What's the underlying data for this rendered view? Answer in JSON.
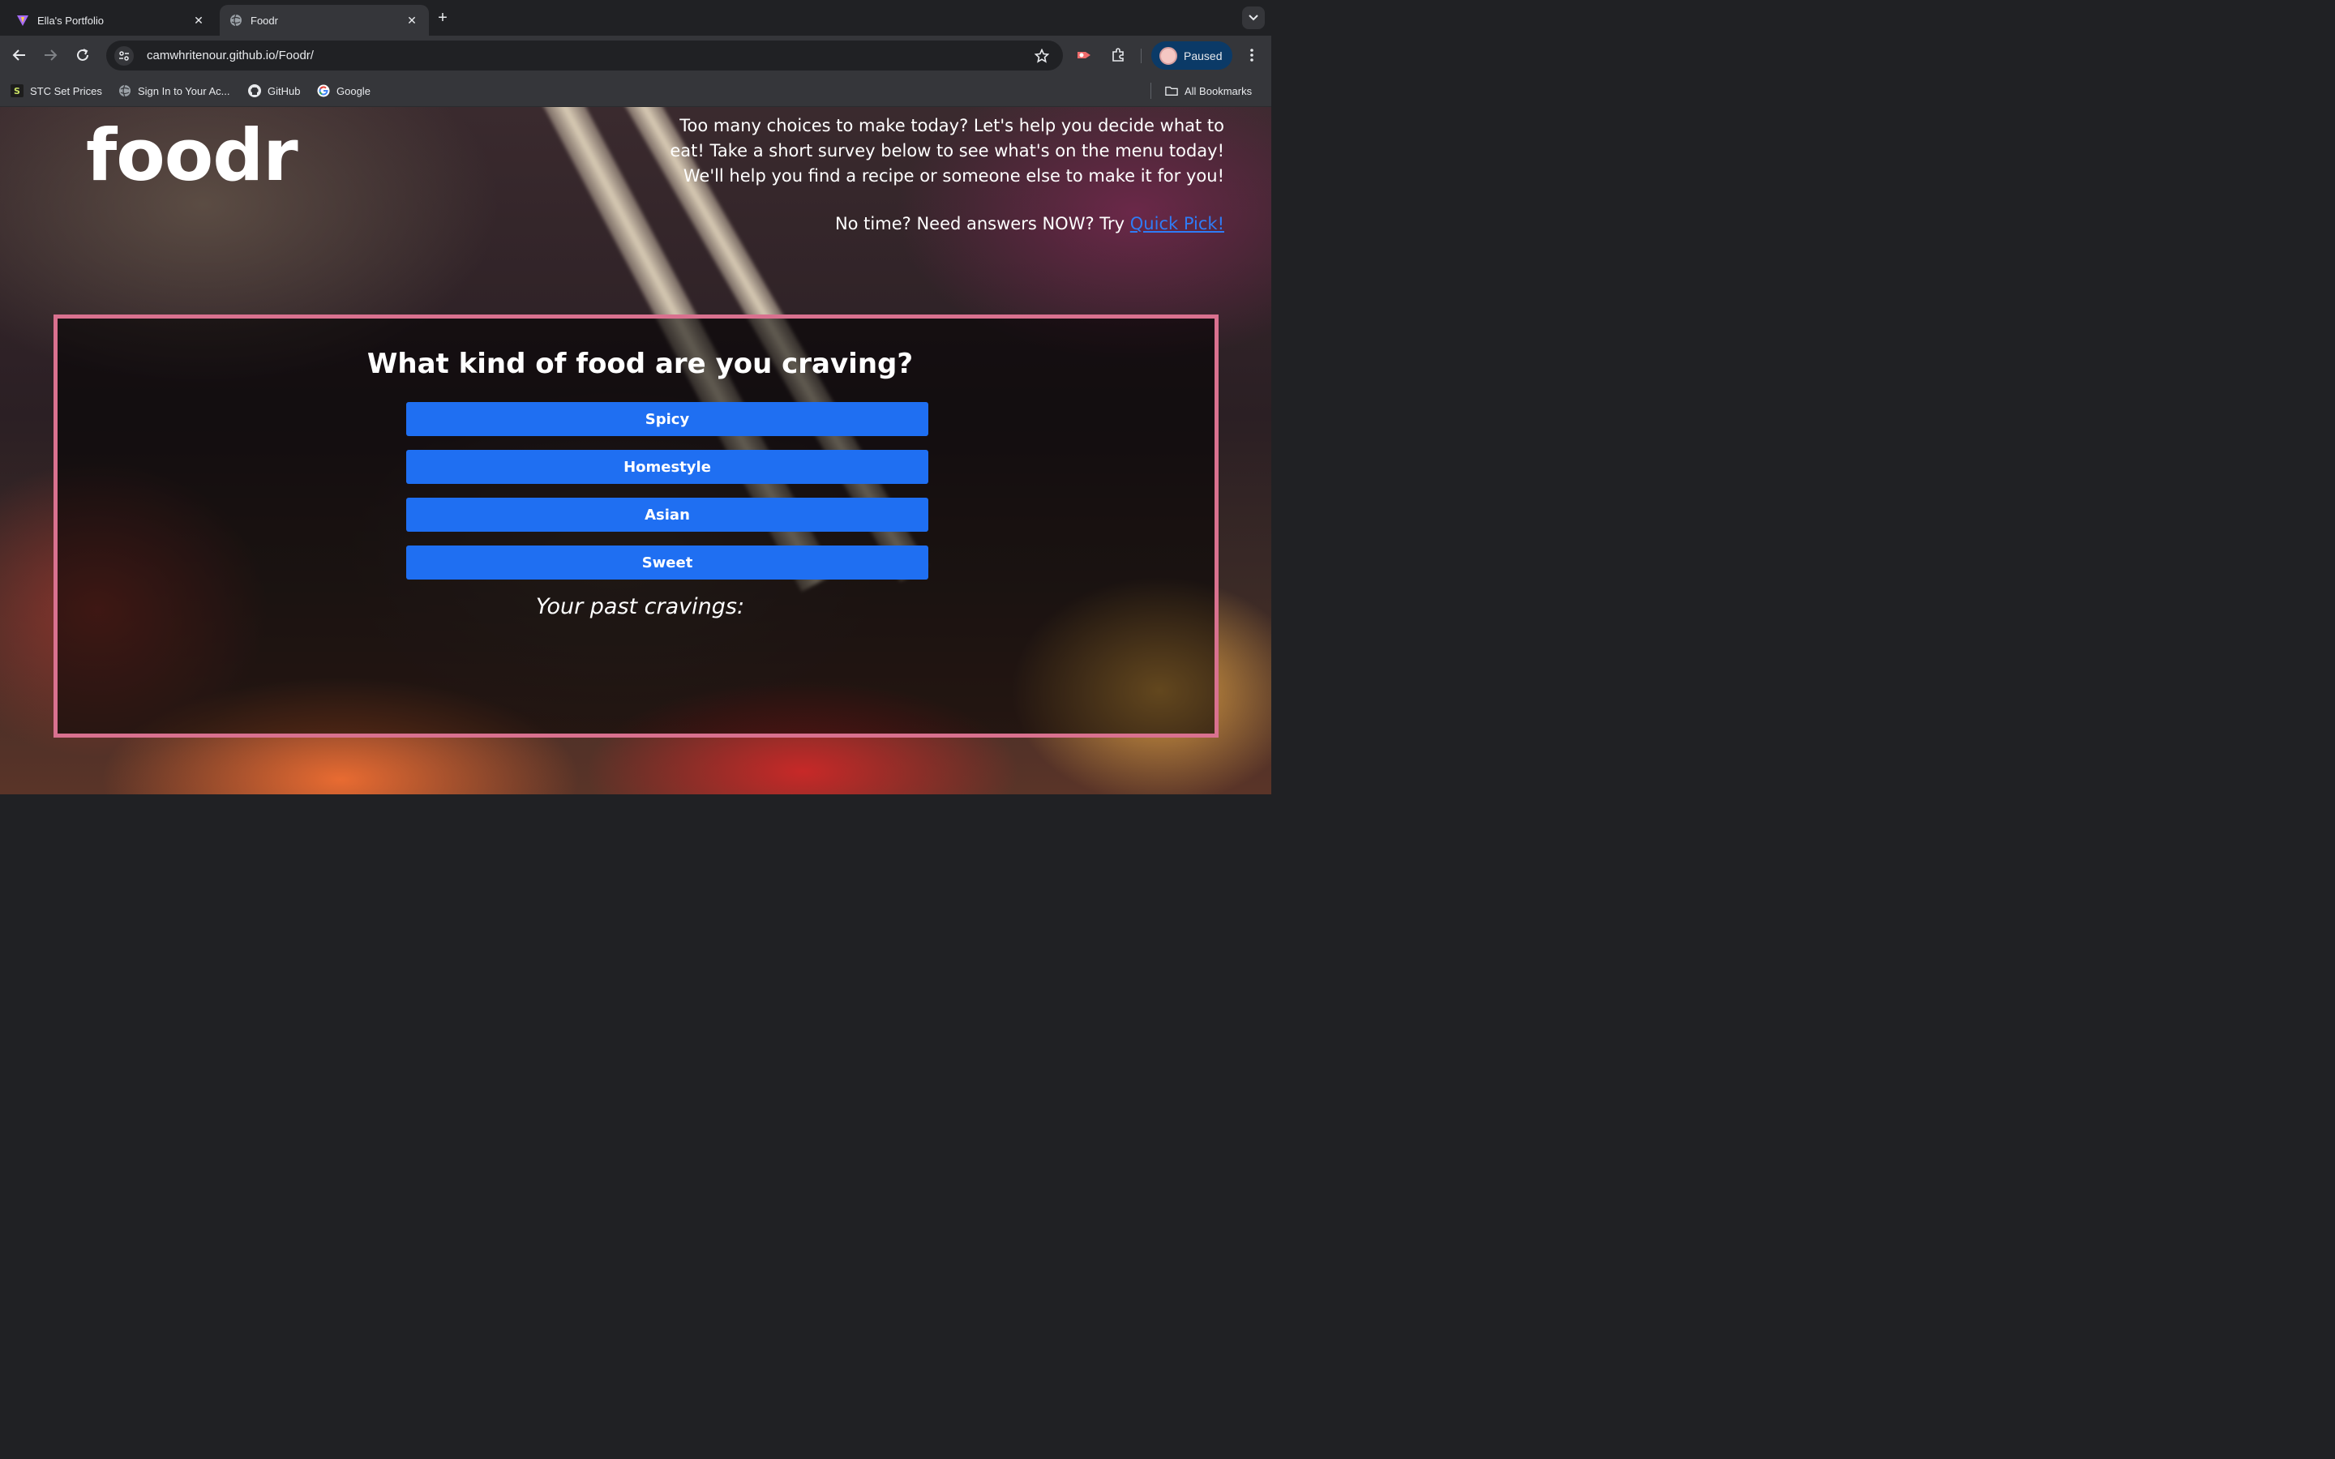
{
  "browser": {
    "tabs": [
      {
        "title": "Ella's Portfolio",
        "favicon": "vite-logo-icon",
        "active": false
      },
      {
        "title": "Foodr",
        "favicon": "globe-icon",
        "active": true
      }
    ],
    "url": "camwhritenour.github.io/Foodr/",
    "profile_label": "Paused",
    "bookmarks": [
      {
        "label": "STC Set Prices",
        "icon": "s-box-icon"
      },
      {
        "label": "Sign In to Your Ac...",
        "icon": "globe-icon"
      },
      {
        "label": "GitHub",
        "icon": "github-icon"
      },
      {
        "label": "Google",
        "icon": "google-icon"
      }
    ],
    "all_bookmarks_label": "All Bookmarks"
  },
  "page": {
    "logo": "foodr",
    "intro": "Too many choices to make today? Let's help you decide what to eat! Take a short survey below to see what's on the menu today! We'll help you find a recipe or someone else to make it for you!",
    "quick_prefix": "No time? Need answers NOW? Try ",
    "quick_link": "Quick Pick!",
    "question": "What kind of food are you craving?",
    "choices": [
      "Spicy",
      "Homestyle",
      "Asian",
      "Sweet"
    ],
    "past_label": "Your past cravings:",
    "colors": {
      "accent_blue": "#1f6ff2",
      "link_blue": "#2f7cf6",
      "survey_border": "#d9718f"
    }
  }
}
